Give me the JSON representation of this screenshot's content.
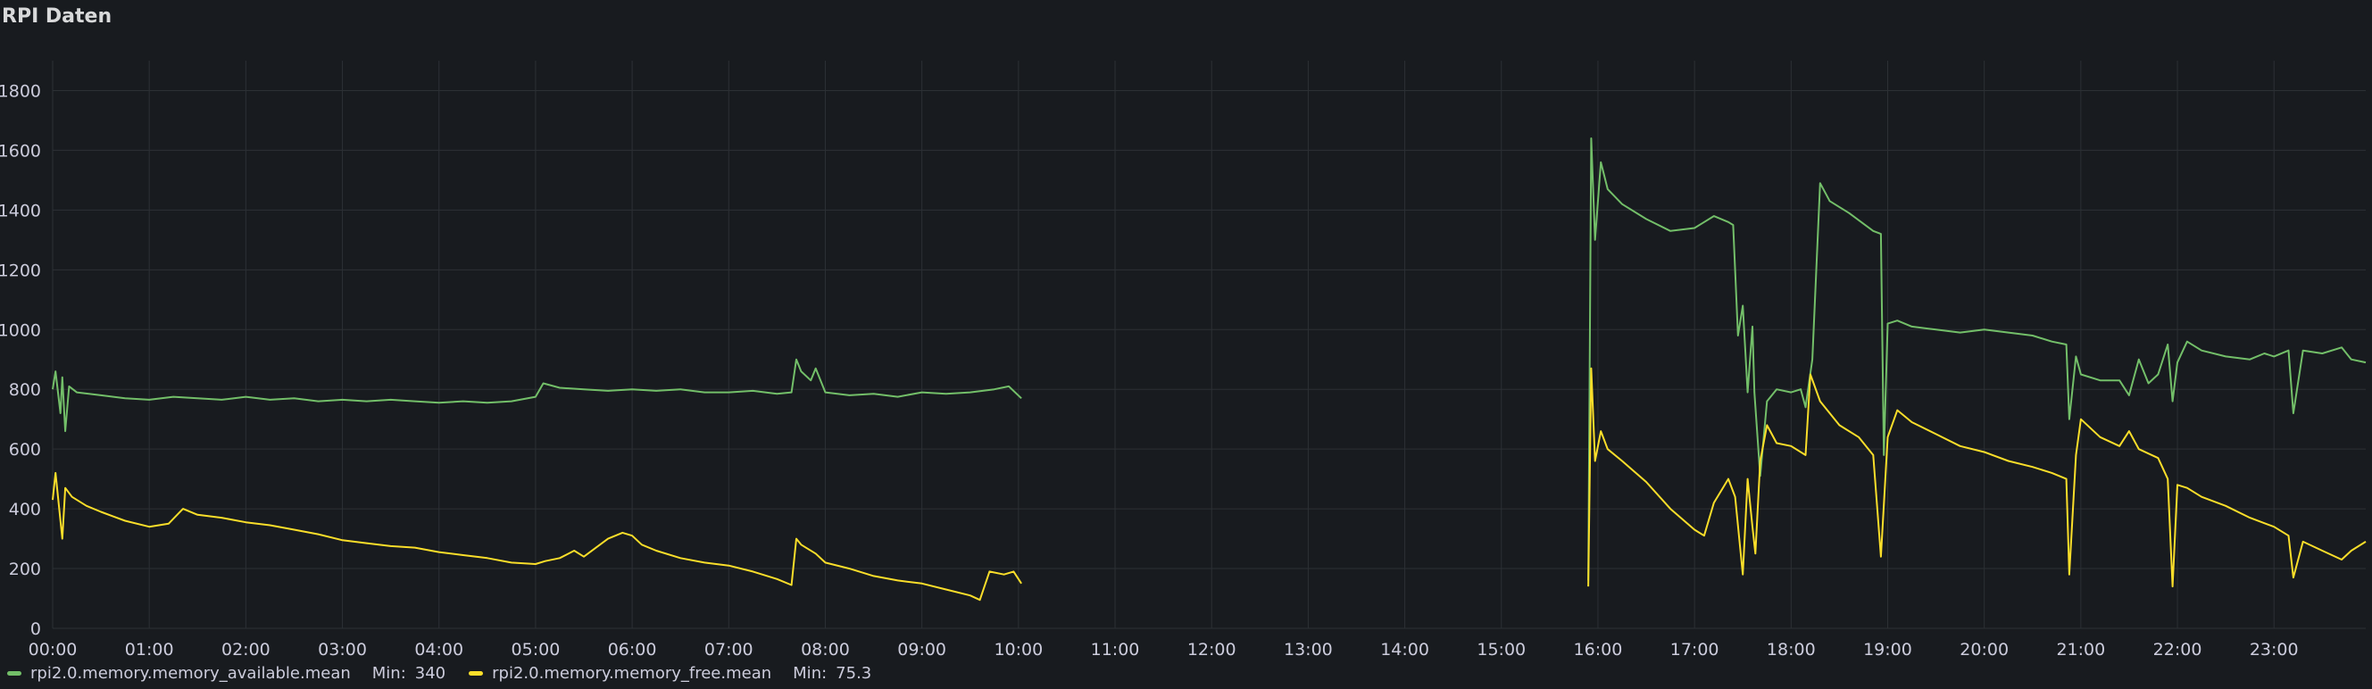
{
  "panel": {
    "title": "RPI Daten"
  },
  "colors": {
    "background": "#181b1f",
    "grid": "#2c3035",
    "text": "#ccccdc",
    "series_available": "#73bf69",
    "series_free": "#fade2a"
  },
  "legend": [
    {
      "name": "rpi2.0.memory.memory_available.mean",
      "min_label": "Min:",
      "min_value": "340",
      "color": "#73bf69"
    },
    {
      "name": "rpi2.0.memory.memory_free.mean",
      "min_label": "Min:",
      "min_value": "75.3",
      "color": "#fade2a"
    }
  ],
  "chart_data": {
    "type": "line",
    "title": "RPI Daten",
    "xlabel": "",
    "ylabel": "",
    "x_unit": "hour of day",
    "xlim": [
      0,
      23.95
    ],
    "ylim": [
      0,
      1900
    ],
    "yticks": [
      0,
      200,
      400,
      600,
      800,
      1000,
      1200,
      1400,
      1600,
      1800
    ],
    "xticks": [
      "00:00",
      "01:00",
      "02:00",
      "03:00",
      "04:00",
      "05:00",
      "06:00",
      "07:00",
      "08:00",
      "09:00",
      "10:00",
      "11:00",
      "12:00",
      "13:00",
      "14:00",
      "15:00",
      "16:00",
      "17:00",
      "18:00",
      "19:00",
      "20:00",
      "21:00",
      "22:00",
      "23:00"
    ],
    "grid": true,
    "legend_position": "bottom-left",
    "series": [
      {
        "name": "rpi2.0.memory.memory_available.mean",
        "color": "#73bf69",
        "segments": [
          [
            [
              0.0,
              800
            ],
            [
              0.03,
              860
            ],
            [
              0.08,
              720
            ],
            [
              0.1,
              840
            ],
            [
              0.13,
              660
            ],
            [
              0.17,
              810
            ],
            [
              0.25,
              790
            ],
            [
              0.5,
              780
            ],
            [
              0.75,
              770
            ],
            [
              1.0,
              765
            ],
            [
              1.25,
              775
            ],
            [
              1.5,
              770
            ],
            [
              1.75,
              765
            ],
            [
              2.0,
              775
            ],
            [
              2.25,
              765
            ],
            [
              2.5,
              770
            ],
            [
              2.75,
              760
            ],
            [
              3.0,
              765
            ],
            [
              3.25,
              760
            ],
            [
              3.5,
              765
            ],
            [
              3.75,
              760
            ],
            [
              4.0,
              755
            ],
            [
              4.25,
              760
            ],
            [
              4.5,
              755
            ],
            [
              4.75,
              760
            ],
            [
              5.0,
              775
            ],
            [
              5.08,
              820
            ],
            [
              5.25,
              805
            ],
            [
              5.5,
              800
            ],
            [
              5.75,
              795
            ],
            [
              6.0,
              800
            ],
            [
              6.25,
              795
            ],
            [
              6.5,
              800
            ],
            [
              6.75,
              790
            ],
            [
              7.0,
              790
            ],
            [
              7.25,
              795
            ],
            [
              7.5,
              785
            ],
            [
              7.65,
              790
            ],
            [
              7.7,
              900
            ],
            [
              7.75,
              860
            ],
            [
              7.85,
              830
            ],
            [
              7.9,
              870
            ],
            [
              8.0,
              790
            ],
            [
              8.25,
              780
            ],
            [
              8.5,
              785
            ],
            [
              8.75,
              775
            ],
            [
              9.0,
              790
            ],
            [
              9.25,
              785
            ],
            [
              9.5,
              790
            ],
            [
              9.75,
              800
            ],
            [
              9.9,
              810
            ],
            [
              10.03,
              770
            ]
          ],
          [
            [
              15.9,
              160
            ],
            [
              15.93,
              1640
            ],
            [
              15.97,
              1300
            ],
            [
              16.03,
              1560
            ],
            [
              16.1,
              1470
            ],
            [
              16.25,
              1420
            ],
            [
              16.5,
              1370
            ],
            [
              16.75,
              1330
            ],
            [
              17.0,
              1340
            ],
            [
              17.2,
              1380
            ],
            [
              17.35,
              1360
            ],
            [
              17.4,
              1350
            ],
            [
              17.45,
              980
            ],
            [
              17.5,
              1080
            ],
            [
              17.55,
              790
            ],
            [
              17.6,
              1010
            ],
            [
              17.62,
              790
            ],
            [
              17.68,
              510
            ],
            [
              17.75,
              760
            ],
            [
              17.85,
              800
            ],
            [
              18.0,
              790
            ],
            [
              18.1,
              800
            ],
            [
              18.15,
              740
            ],
            [
              18.22,
              900
            ],
            [
              18.3,
              1490
            ],
            [
              18.4,
              1430
            ],
            [
              18.6,
              1390
            ],
            [
              18.85,
              1330
            ],
            [
              18.93,
              1320
            ],
            [
              18.96,
              580
            ],
            [
              19.0,
              1020
            ],
            [
              19.1,
              1030
            ],
            [
              19.25,
              1010
            ],
            [
              19.5,
              1000
            ],
            [
              19.75,
              990
            ],
            [
              20.0,
              1000
            ],
            [
              20.25,
              990
            ],
            [
              20.5,
              980
            ],
            [
              20.7,
              960
            ],
            [
              20.85,
              950
            ],
            [
              20.88,
              700
            ],
            [
              20.95,
              910
            ],
            [
              21.0,
              850
            ],
            [
              21.2,
              830
            ],
            [
              21.4,
              830
            ],
            [
              21.5,
              780
            ],
            [
              21.6,
              900
            ],
            [
              21.7,
              820
            ],
            [
              21.8,
              850
            ],
            [
              21.9,
              950
            ],
            [
              21.95,
              760
            ],
            [
              22.0,
              890
            ],
            [
              22.1,
              960
            ],
            [
              22.25,
              930
            ],
            [
              22.5,
              910
            ],
            [
              22.75,
              900
            ],
            [
              22.9,
              920
            ],
            [
              23.0,
              910
            ],
            [
              23.15,
              930
            ],
            [
              23.2,
              720
            ],
            [
              23.3,
              930
            ],
            [
              23.5,
              920
            ],
            [
              23.7,
              940
            ],
            [
              23.8,
              900
            ],
            [
              23.95,
              890
            ]
          ]
        ]
      },
      {
        "name": "rpi2.0.memory.memory_free.mean",
        "color": "#fade2a",
        "segments": [
          [
            [
              0.0,
              430
            ],
            [
              0.03,
              520
            ],
            [
              0.1,
              300
            ],
            [
              0.13,
              470
            ],
            [
              0.2,
              440
            ],
            [
              0.35,
              410
            ],
            [
              0.5,
              390
            ],
            [
              0.75,
              360
            ],
            [
              1.0,
              340
            ],
            [
              1.2,
              350
            ],
            [
              1.35,
              400
            ],
            [
              1.5,
              380
            ],
            [
              1.75,
              370
            ],
            [
              2.0,
              355
            ],
            [
              2.25,
              345
            ],
            [
              2.5,
              330
            ],
            [
              2.75,
              315
            ],
            [
              3.0,
              295
            ],
            [
              3.25,
              285
            ],
            [
              3.5,
              275
            ],
            [
              3.75,
              270
            ],
            [
              4.0,
              255
            ],
            [
              4.25,
              245
            ],
            [
              4.5,
              235
            ],
            [
              4.75,
              220
            ],
            [
              5.0,
              215
            ],
            [
              5.1,
              225
            ],
            [
              5.25,
              235
            ],
            [
              5.4,
              260
            ],
            [
              5.5,
              240
            ],
            [
              5.75,
              300
            ],
            [
              5.9,
              320
            ],
            [
              6.0,
              310
            ],
            [
              6.1,
              280
            ],
            [
              6.25,
              260
            ],
            [
              6.5,
              235
            ],
            [
              6.75,
              220
            ],
            [
              7.0,
              210
            ],
            [
              7.25,
              190
            ],
            [
              7.5,
              165
            ],
            [
              7.65,
              145
            ],
            [
              7.7,
              300
            ],
            [
              7.75,
              280
            ],
            [
              7.9,
              250
            ],
            [
              8.0,
              220
            ],
            [
              8.25,
              200
            ],
            [
              8.5,
              175
            ],
            [
              8.75,
              160
            ],
            [
              9.0,
              150
            ],
            [
              9.25,
              130
            ],
            [
              9.5,
              110
            ],
            [
              9.6,
              95
            ],
            [
              9.7,
              190
            ],
            [
              9.85,
              180
            ],
            [
              9.95,
              190
            ],
            [
              10.03,
              150
            ]
          ],
          [
            [
              15.9,
              140
            ],
            [
              15.93,
              870
            ],
            [
              15.97,
              560
            ],
            [
              16.03,
              660
            ],
            [
              16.1,
              600
            ],
            [
              16.25,
              560
            ],
            [
              16.5,
              490
            ],
            [
              16.75,
              400
            ],
            [
              17.0,
              330
            ],
            [
              17.1,
              310
            ],
            [
              17.2,
              420
            ],
            [
              17.35,
              500
            ],
            [
              17.42,
              440
            ],
            [
              17.5,
              180
            ],
            [
              17.55,
              500
            ],
            [
              17.6,
              340
            ],
            [
              17.63,
              250
            ],
            [
              17.68,
              560
            ],
            [
              17.75,
              680
            ],
            [
              17.85,
              620
            ],
            [
              18.0,
              610
            ],
            [
              18.15,
              580
            ],
            [
              18.2,
              850
            ],
            [
              18.3,
              760
            ],
            [
              18.5,
              680
            ],
            [
              18.7,
              640
            ],
            [
              18.85,
              580
            ],
            [
              18.93,
              240
            ],
            [
              19.0,
              640
            ],
            [
              19.1,
              730
            ],
            [
              19.25,
              690
            ],
            [
              19.5,
              650
            ],
            [
              19.75,
              610
            ],
            [
              20.0,
              590
            ],
            [
              20.25,
              560
            ],
            [
              20.5,
              540
            ],
            [
              20.7,
              520
            ],
            [
              20.85,
              500
            ],
            [
              20.88,
              180
            ],
            [
              20.95,
              580
            ],
            [
              21.0,
              700
            ],
            [
              21.2,
              640
            ],
            [
              21.4,
              610
            ],
            [
              21.5,
              660
            ],
            [
              21.6,
              600
            ],
            [
              21.8,
              570
            ],
            [
              21.9,
              500
            ],
            [
              21.95,
              140
            ],
            [
              22.0,
              480
            ],
            [
              22.1,
              470
            ],
            [
              22.25,
              440
            ],
            [
              22.5,
              410
            ],
            [
              22.75,
              370
            ],
            [
              23.0,
              340
            ],
            [
              23.15,
              310
            ],
            [
              23.2,
              170
            ],
            [
              23.3,
              290
            ],
            [
              23.5,
              260
            ],
            [
              23.7,
              230
            ],
            [
              23.8,
              260
            ],
            [
              23.95,
              290
            ]
          ]
        ]
      }
    ]
  }
}
